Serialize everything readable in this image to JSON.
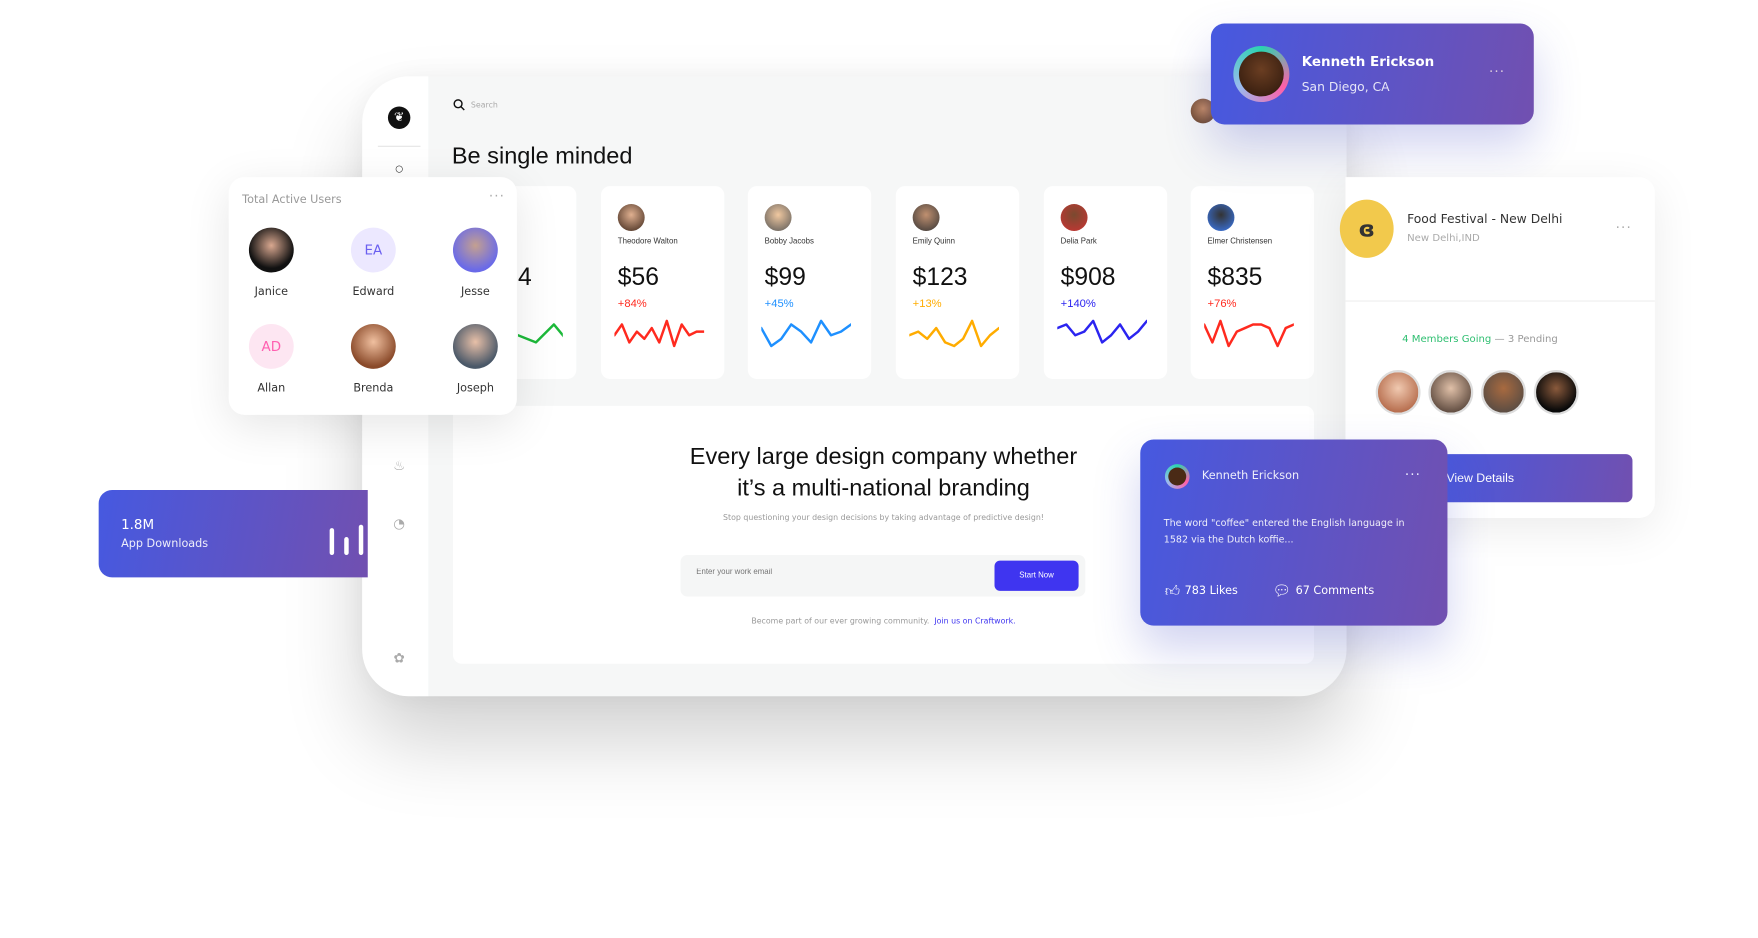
{
  "search": {
    "placeholder": "Search"
  },
  "page_title": "Be single minded",
  "stats": [
    {
      "name": "",
      "value": "4",
      "change": "",
      "color": "#1db93a",
      "spark": [
        5,
        3,
        8,
        2,
        7,
        9
      ]
    },
    {
      "name": "Theodore Walton",
      "value": "$56",
      "change": "+84%",
      "color": "#ff2a1f",
      "spark": [
        5,
        8,
        3,
        6,
        4,
        7,
        3,
        9,
        2,
        8,
        5,
        6,
        6
      ]
    },
    {
      "name": "Bobby Jacobs",
      "value": "$99",
      "change": "+45%",
      "color": "#1e90ff",
      "spark": [
        7,
        2,
        4,
        8,
        6,
        3,
        9,
        5,
        6,
        8
      ]
    },
    {
      "name": "Emily Quinn",
      "value": "$123",
      "change": "+13%",
      "color": "#ffac00",
      "spark": [
        5,
        6,
        4,
        7,
        3,
        2,
        4,
        9,
        2,
        5,
        7
      ]
    },
    {
      "name": "Delia Park",
      "value": "$908",
      "change": "+140%",
      "color": "#2b24f0",
      "spark": [
        7,
        8,
        5,
        6,
        9,
        3,
        5,
        8,
        4,
        6,
        9
      ]
    },
    {
      "name": "Elmer Christensen",
      "value": "$835",
      "change": "+76%",
      "color": "#ff2a1f",
      "spark": [
        8,
        3,
        9,
        2,
        6,
        7,
        8,
        8,
        7,
        2,
        7,
        8
      ]
    }
  ],
  "hero": {
    "heading_line1": "Every large design company whether",
    "heading_line2": "it’s a multi-national branding",
    "subtitle": "Stop questioning your design decisions by taking advantage of predictive design!",
    "email_placeholder": "Enter your work email",
    "button": "Start Now",
    "footer_text": "Become part of our ever growing community.",
    "footer_link": "Join us on Craftwork."
  },
  "active_users": {
    "title": "Total Active Users",
    "users": [
      {
        "name": "Janice",
        "initials": ""
      },
      {
        "name": "Edward",
        "initials": "EA"
      },
      {
        "name": "Jesse",
        "initials": ""
      },
      {
        "name": "Allan",
        "initials": "AD"
      },
      {
        "name": "Brenda",
        "initials": ""
      },
      {
        "name": "Joseph",
        "initials": ""
      }
    ]
  },
  "downloads": {
    "value": "1.8M",
    "label": "App Downloads",
    "bars": [
      0.75,
      0.5,
      0.85
    ]
  },
  "profile_card": {
    "name": "Kenneth Erickson",
    "location": "San Diego, CA"
  },
  "event": {
    "title": "Food Festival - New Delhi",
    "location": "New Delhi,IND",
    "going": "4 Members Going",
    "pending": "— 3 Pending",
    "button": "View Details"
  },
  "post": {
    "author": "Kenneth Erickson",
    "text": "The word \"coffee\" entered the English language in 1582 via the Dutch koffie...",
    "likes": "783 Likes",
    "comments": "67 Comments"
  },
  "colors": {
    "accent": "#3f35f0",
    "gradient_start": "#4659e0",
    "gradient_end": "#7150b0",
    "going": "#2fbf71"
  }
}
